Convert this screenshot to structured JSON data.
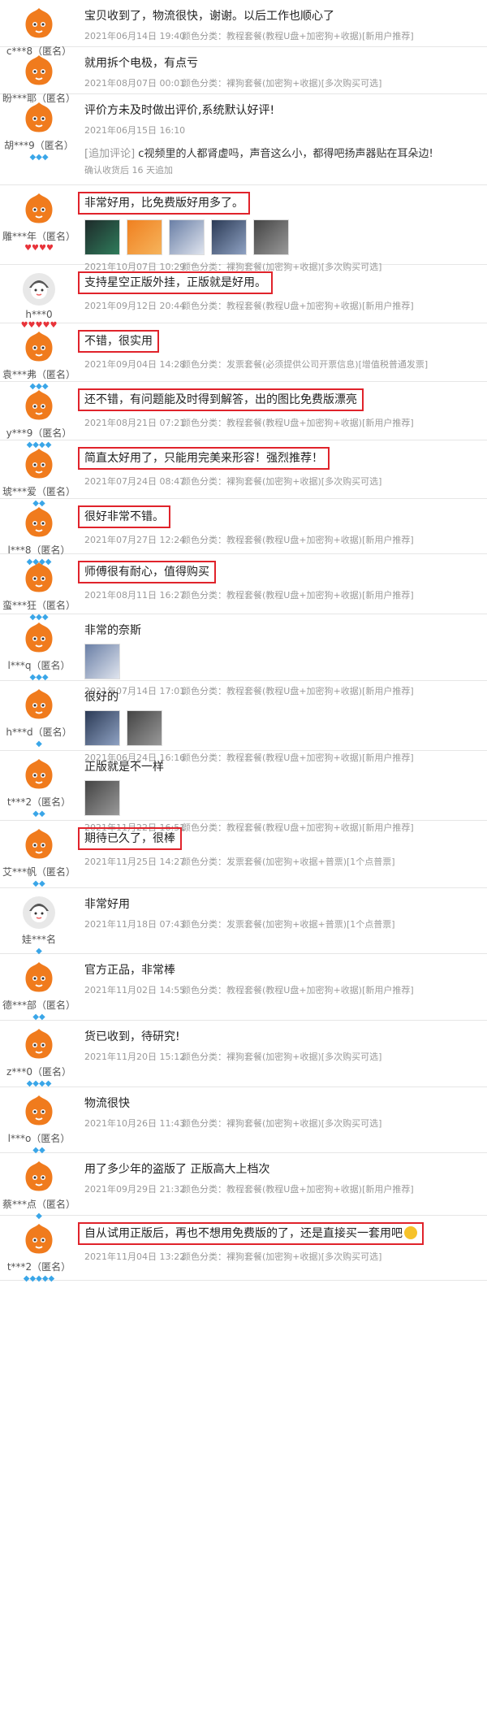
{
  "reviews": [
    {
      "user": "c***8（匿名）",
      "badge": "gem",
      "badge_count": 2,
      "avatar": "mascot",
      "text": "宝贝收到了，物流很快，谢谢。以后工作也顺心了",
      "date": "2021年06月14日 19:40",
      "variant": "颜色分类：教程套餐(教程U盘+加密狗+收据)[新用户推荐]",
      "thumbs": 0,
      "highlight": false
    },
    {
      "user": "盼***耶（匿名）",
      "badge": "gem",
      "badge_count": 2,
      "avatar": "mascot",
      "text": "就用拆个电极，有点亏",
      "date": "2021年08月07日 00:01",
      "variant": "颜色分类：裸狗套餐(加密狗+收据)[多次购买可选]",
      "thumbs": 0,
      "highlight": false
    },
    {
      "user": "胡***9（匿名）",
      "badge": "gem",
      "badge_count": 3,
      "avatar": "mascot",
      "text": "评价方未及时做出评价,系统默认好评!",
      "date": "2021年06月15日 16:10",
      "variant": "",
      "thumbs": 0,
      "highlight": false,
      "append_tag": "[追加评论]",
      "append_text": "c视频里的人都肾虚吗，声音这么小，都得吧扬声器贴在耳朵边!",
      "confirm": "确认收货后 16 天追加"
    },
    {
      "user": "雕***年（匿名）",
      "badge": "heart",
      "badge_count": 4,
      "avatar": "mascot",
      "text": "非常好用，比免费版好用多了。",
      "date": "2021年10月07日 10:29",
      "variant": "颜色分类：裸狗套餐(加密狗+收据)[多次购买可选]",
      "thumbs": 5,
      "highlight": true
    },
    {
      "user": "h***0",
      "badge": "heart",
      "badge_count": 5,
      "avatar": "default",
      "text": "支持星空正版外挂，正版就是好用。",
      "date": "2021年09月12日 20:44",
      "variant": "颜色分类：教程套餐(教程U盘+加密狗+收据)[新用户推荐]",
      "thumbs": 0,
      "highlight": true
    },
    {
      "user": "袁***弗（匿名）",
      "badge": "gem",
      "badge_count": 3,
      "avatar": "mascot",
      "text": "不错，很实用",
      "date": "2021年09月04日 14:28",
      "variant": "颜色分类：发票套餐(必须提供公司开票信息)[增值税普通发票]",
      "thumbs": 0,
      "highlight": true
    },
    {
      "user": "y***9（匿名）",
      "badge": "gem",
      "badge_count": 4,
      "avatar": "mascot",
      "text": "还不错，有问题能及时得到解答，出的图比免费版漂亮",
      "date": "2021年08月21日 07:21",
      "variant": "颜色分类：教程套餐(教程U盘+加密狗+收据)[新用户推荐]",
      "thumbs": 0,
      "highlight": true
    },
    {
      "user": "琥***爱（匿名）",
      "badge": "gem",
      "badge_count": 2,
      "avatar": "mascot",
      "text": "简直太好用了，只能用完美来形容！强烈推荐！",
      "date": "2021年07月24日 08:47",
      "variant": "颜色分类：裸狗套餐(加密狗+收据)[多次购买可选]",
      "thumbs": 0,
      "highlight": true
    },
    {
      "user": "l***8（匿名）",
      "badge": "gem",
      "badge_count": 4,
      "avatar": "mascot",
      "text": "很好非常不错。",
      "date": "2021年07月27日 12:24",
      "variant": "颜色分类：教程套餐(教程U盘+加密狗+收据)[新用户推荐]",
      "thumbs": 0,
      "highlight": true
    },
    {
      "user": "蛮***狂（匿名）",
      "badge": "gem",
      "badge_count": 3,
      "avatar": "mascot",
      "text": "师傅很有耐心，值得购买",
      "date": "2021年08月11日 16:27",
      "variant": "颜色分类：教程套餐(教程U盘+加密狗+收据)[新用户推荐]",
      "thumbs": 0,
      "highlight": true
    },
    {
      "user": "l***q（匿名）",
      "badge": "gem",
      "badge_count": 3,
      "avatar": "mascot",
      "text": "非常的奈斯",
      "date": "2021年07月14日 17:01",
      "variant": "颜色分类：教程套餐(教程U盘+加密狗+收据)[新用户推荐]",
      "thumbs": 1,
      "highlight": false
    },
    {
      "user": "h***d（匿名）",
      "badge": "gem",
      "badge_count": 1,
      "avatar": "mascot",
      "text": "很好的",
      "date": "2021年06月24日 16:16",
      "variant": "颜色分类：教程套餐(教程U盘+加密狗+收据)[新用户推荐]",
      "thumbs": 2,
      "highlight": false
    },
    {
      "user": "t***2（匿名）",
      "badge": "gem",
      "badge_count": 2,
      "avatar": "mascot",
      "text": "正版就是不一样",
      "date": "2021年11月22日 16:51",
      "variant": "颜色分类：教程套餐(教程U盘+加密狗+收据)[新用户推荐]",
      "thumbs": 1,
      "highlight": false
    },
    {
      "user": "艾***帆（匿名）",
      "badge": "gem",
      "badge_count": 2,
      "avatar": "mascot",
      "text": "期待已久了，很棒",
      "date": "2021年11月25日 14:27",
      "variant": "颜色分类：发票套餐(加密狗+收据+普票)[1个点普票]",
      "thumbs": 0,
      "highlight": true
    },
    {
      "user": "娃***名",
      "badge": "gem",
      "badge_count": 1,
      "avatar": "default",
      "text": "非常好用",
      "date": "2021年11月18日 07:43",
      "variant": "颜色分类：发票套餐(加密狗+收据+普票)[1个点普票]",
      "thumbs": 0,
      "highlight": false
    },
    {
      "user": "德***部（匿名）",
      "badge": "gem",
      "badge_count": 2,
      "avatar": "mascot",
      "text": "官方正品，非常棒",
      "date": "2021年11月02日 14:55",
      "variant": "颜色分类：教程套餐(教程U盘+加密狗+收据)[新用户推荐]",
      "thumbs": 0,
      "highlight": false
    },
    {
      "user": "z***0（匿名）",
      "badge": "gem",
      "badge_count": 4,
      "avatar": "mascot",
      "text": "货已收到，待研究!",
      "date": "2021年11月20日 15:12",
      "variant": "颜色分类：裸狗套餐(加密狗+收据)[多次购买可选]",
      "thumbs": 0,
      "highlight": false
    },
    {
      "user": "l***o（匿名）",
      "badge": "gem",
      "badge_count": 2,
      "avatar": "mascot",
      "text": "物流很快",
      "date": "2021年10月26日 11:43",
      "variant": "颜色分类：裸狗套餐(加密狗+收据)[多次购买可选]",
      "thumbs": 0,
      "highlight": false
    },
    {
      "user": "蔡***点（匿名）",
      "badge": "gem",
      "badge_count": 1,
      "avatar": "mascot",
      "text": "用了多少年的盗版了 正版高大上档次",
      "date": "2021年09月29日 21:32",
      "variant": "颜色分类：教程套餐(教程U盘+加密狗+收据)[新用户推荐]",
      "thumbs": 0,
      "highlight": false
    },
    {
      "user": "t***2（匿名）",
      "badge": "gem",
      "badge_count": 5,
      "avatar": "mascot",
      "text": "自从试用正版后，再也不想用免费版的了，还是直接买一套用吧",
      "date": "2021年11月04日 13:22",
      "variant": "颜色分类：裸狗套餐(加密狗+收据)[多次购买可选]",
      "thumbs": 0,
      "highlight": true,
      "emoji": true
    }
  ]
}
